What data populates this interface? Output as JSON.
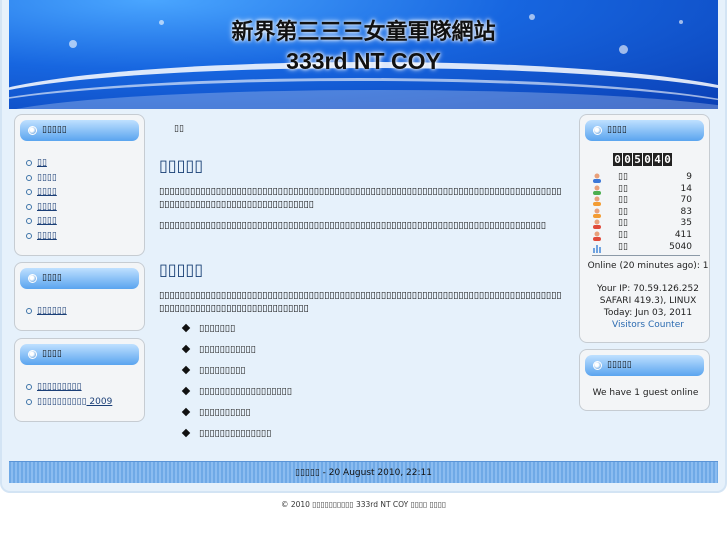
{
  "header": {
    "title": "新界第三三三女童軍隊網站",
    "subtitle": "333rd NT COY"
  },
  "left": {
    "mainmenu": {
      "title": "▯▯▯▯▯",
      "items": [
        "▯▯",
        "▯▯▯▯",
        "▯▯▯▯",
        "▯▯▯▯",
        "▯▯▯▯",
        "▯▯▯▯"
      ]
    },
    "module2": {
      "title": "▯▯▯▯",
      "items": [
        "▯▯▯▯▯▯"
      ]
    },
    "module3": {
      "title": "▯▯▯▯",
      "items": [
        "▯▯▯▯▯▯▯▯▯",
        "▯▯▯▯▯▯▯▯▯▯ 2009"
      ]
    }
  },
  "content": {
    "breadcrumb": "▯▯",
    "article1_title": "▯▯▯▯▯",
    "article1_p1": "▯▯▯▯▯▯▯▯▯▯▯▯▯▯▯▯▯▯▯▯▯▯▯▯▯▯▯▯▯▯▯▯▯▯▯▯▯▯▯▯▯▯▯▯▯▯▯▯▯▯▯▯▯▯▯▯▯▯▯▯▯▯▯▯▯▯▯▯▯▯▯▯▯▯▯▯▯▯▯▯▯▯▯▯▯▯▯▯▯▯▯▯▯▯▯▯▯▯▯▯▯▯▯▯▯▯▯▯",
    "article1_p2": "▯▯▯▯▯▯▯▯▯▯▯▯▯▯▯▯▯▯▯▯▯▯▯▯▯▯▯▯▯▯▯▯▯▯▯▯▯▯▯▯▯▯▯▯▯▯▯▯▯▯▯▯▯▯▯▯▯▯▯▯▯▯▯▯▯▯▯▯▯▯▯▯▯▯▯",
    "article2_title": "▯▯▯▯▯",
    "article2_p1": "▯▯▯▯▯▯▯▯▯▯▯▯▯▯▯▯▯▯▯▯▯▯▯▯▯▯▯▯▯▯▯▯▯▯▯▯▯▯▯▯▯▯▯▯▯▯▯▯▯▯▯▯▯▯▯▯▯▯▯▯▯▯▯▯▯▯▯▯▯▯▯▯▯▯▯▯▯▯▯▯▯▯▯▯▯▯▯▯▯▯▯▯▯▯▯▯▯▯▯▯▯▯▯▯▯▯▯",
    "bullets": [
      "▯▯▯▯▯▯▯",
      "▯▯▯▯▯▯▯▯▯▯▯",
      "▯▯▯▯▯▯▯▯▯",
      "▯▯▯▯▯▯▯▯▯▯▯▯▯▯▯▯▯▯",
      "▯▯▯▯▯▯▯▯▯▯",
      "▯▯▯▯▯▯▯▯▯▯▯▯▯▯"
    ]
  },
  "right": {
    "counter": {
      "title": "▯▯▯▯",
      "digits": [
        "0",
        "0",
        "5",
        "0",
        "4",
        "0"
      ],
      "stats": [
        {
          "icon": "user-blue-icon",
          "label": "▯▯",
          "value": "9"
        },
        {
          "icon": "user-green-icon",
          "label": "▯▯",
          "value": "14"
        },
        {
          "icon": "user-orange-icon",
          "label": "▯▯",
          "value": "70"
        },
        {
          "icon": "user-orange-icon",
          "label": "▯▯",
          "value": "83"
        },
        {
          "icon": "user-red-icon",
          "label": "▯▯",
          "value": "35"
        },
        {
          "icon": "user-red-icon",
          "label": "▯▯",
          "value": "411"
        },
        {
          "icon": "chart-icon",
          "label": "▯▯",
          "value": "5040"
        }
      ],
      "online": "Online (20 minutes ago): 1",
      "ip": "Your IP: 70.59.126.252",
      "browser": "SAFARI 419.3), LINUX",
      "today": "Today: Jun 03, 2011",
      "link": "Visitors Counter"
    },
    "whosonline": {
      "title": "▯▯▯▯▯",
      "text": "We have 1 guest online"
    }
  },
  "footer": {
    "bar": "▯▯▯▯▯ - 20 August 2010, 22:11",
    "copyright": "© 2010 ▯▯▯▯▯▯▯▯▯▯ 333rd NT COY ▯▯▯▯ ▯▯▯▯"
  },
  "colors": {
    "header_blue": "#1766e0",
    "module_head": "#5aa4ef",
    "link": "#1b3f77",
    "title": "#173e74"
  }
}
